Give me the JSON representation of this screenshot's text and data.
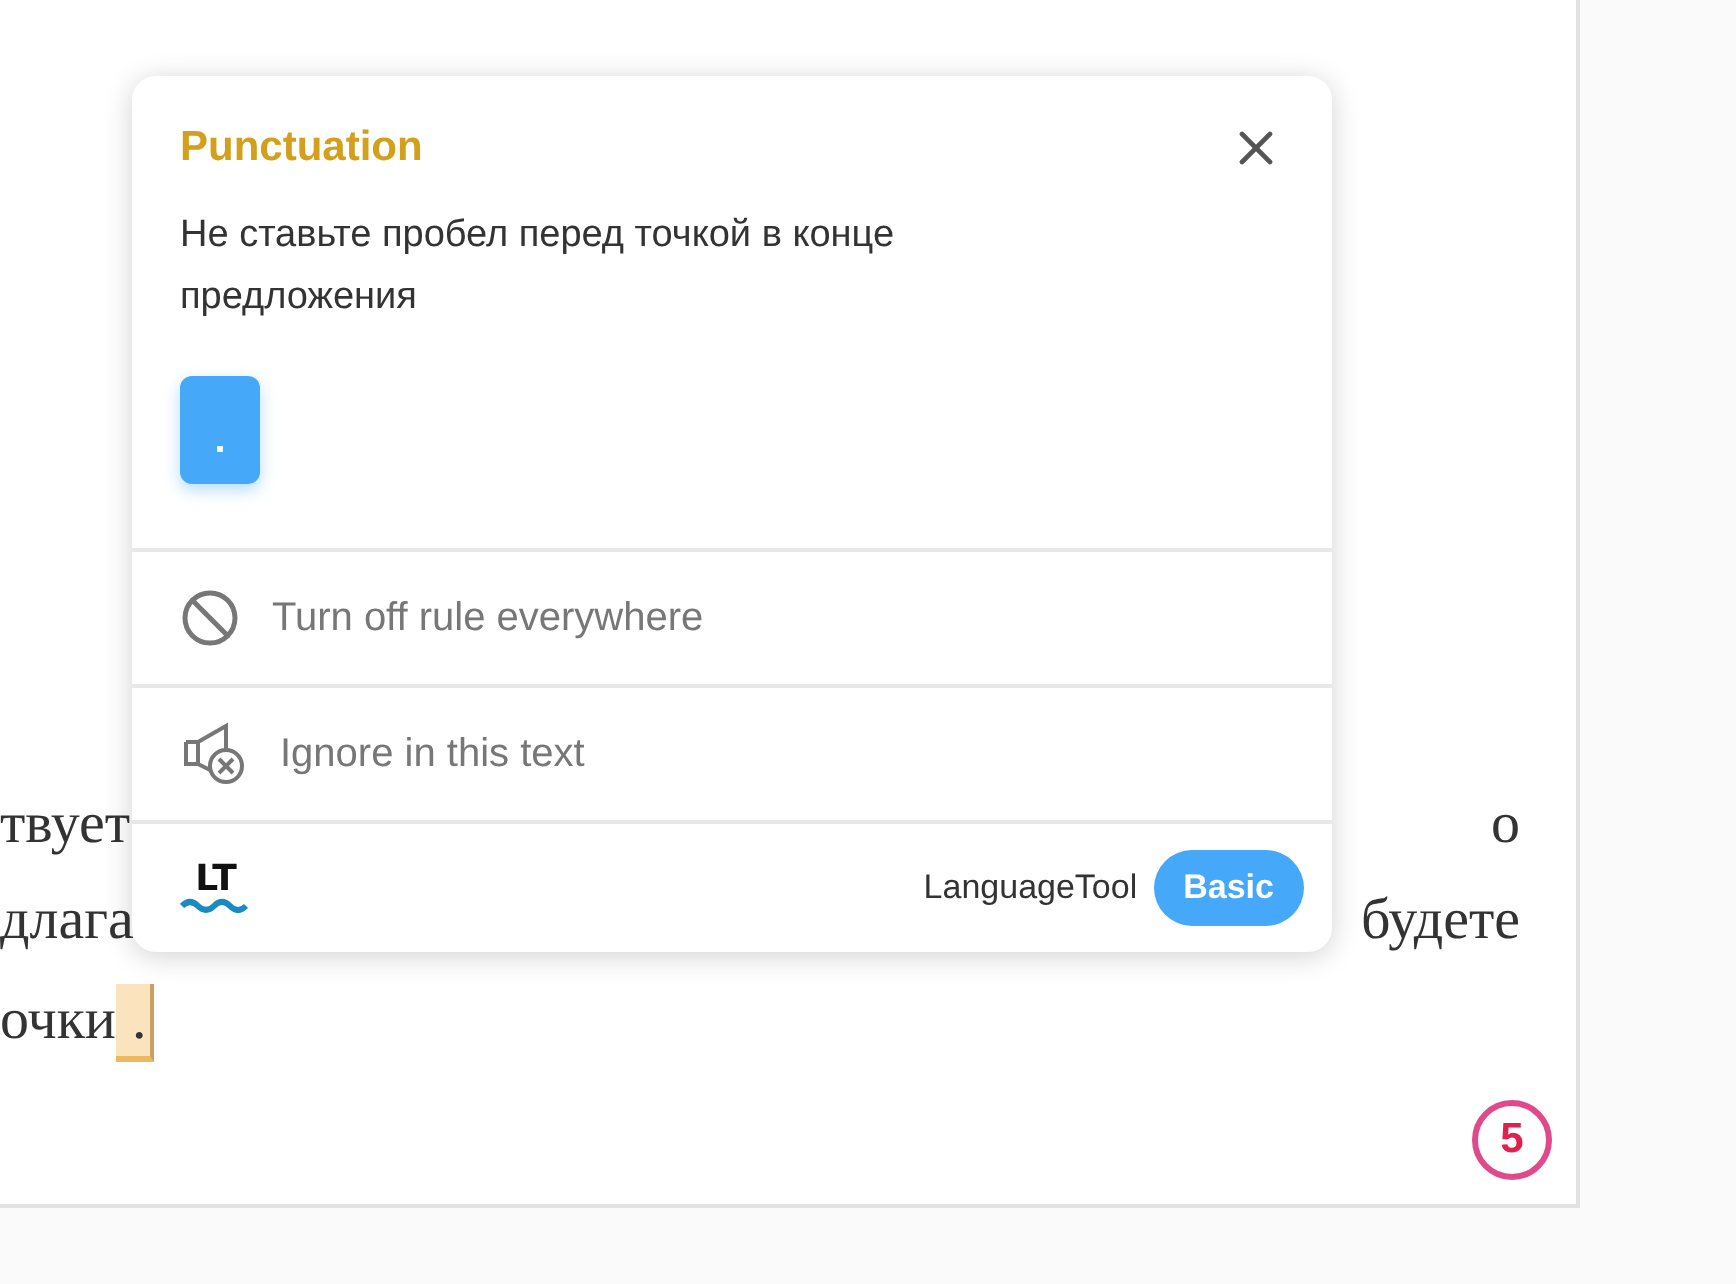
{
  "document": {
    "lines": [
      {
        "left": "твует",
        "right": "о"
      },
      {
        "left": "длага",
        "right": "будете"
      },
      {
        "left": "очки",
        "flagged": "."
      }
    ],
    "page_number": "5"
  },
  "popup": {
    "category": "Punctuation",
    "message": "Не ставьте пробел перед точкой в конце предложения",
    "suggestions": [
      "."
    ],
    "actions": [
      {
        "kind": "disable",
        "label": "Turn off rule everywhere"
      },
      {
        "kind": "ignore",
        "label": "Ignore in this text"
      }
    ],
    "footer": {
      "logo": "LT",
      "brand": "LanguageTool",
      "plan": "Basic"
    }
  }
}
